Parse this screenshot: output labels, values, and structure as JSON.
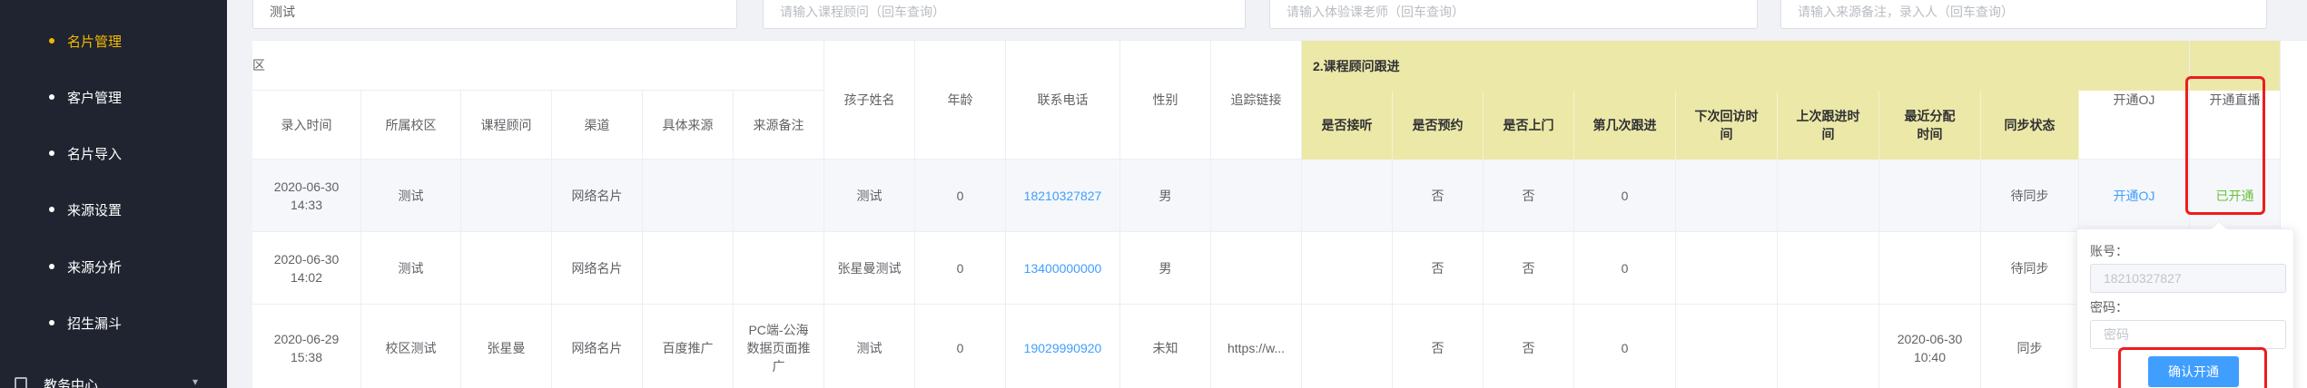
{
  "sidebar": {
    "items": [
      {
        "label": "名片管理",
        "active": true
      },
      {
        "label": "客户管理"
      },
      {
        "label": "名片导入"
      },
      {
        "label": "来源设置"
      },
      {
        "label": "来源分析"
      },
      {
        "label": "招生漏斗"
      }
    ],
    "group": {
      "label": "教务中心"
    }
  },
  "filters": {
    "campus_value": "测试",
    "consultant_placeholder": "请输入课程顾问（回车查询）",
    "teacher_placeholder": "请输入体验课老师（回车查询）",
    "source_placeholder": "请输入来源备注，录入人（回车查询）"
  },
  "table": {
    "group_partial": "区",
    "group2_title": "2.课程顾问跟进",
    "headers": {
      "entry_time": "录入时间",
      "campus": "所属校区",
      "consultant": "课程顾问",
      "channel": "渠道",
      "source": "具体来源",
      "source_note": "来源备注",
      "child_name": "孩子姓名",
      "age": "年龄",
      "phone": "联系电话",
      "gender": "性别",
      "tracking_link": "追踪链接",
      "answered": "是否接听",
      "appointment": "是否预约",
      "visited": "是否上门",
      "follow_count": "第几次跟进",
      "next_visit": "下次回访时间",
      "last_follow": "上次跟进时间",
      "last_assign": "最近分配时间",
      "sync_status": "同步状态",
      "open_oj": "开通OJ",
      "open_live": "开通直播"
    },
    "rows": [
      {
        "entry_time": "2020-06-30 14:33",
        "campus": "测试",
        "consultant": "",
        "channel": "网络名片",
        "source": "",
        "source_note": "",
        "child_name": "测试",
        "age": "0",
        "phone": "18210327827",
        "gender": "男",
        "tracking_link": "",
        "answered": "",
        "appointment": "否",
        "visited": "否",
        "follow_count": "0",
        "next_visit": "",
        "last_follow": "",
        "last_assign": "",
        "sync_status": "待同步",
        "open_oj": "开通OJ",
        "open_live": "已开通"
      },
      {
        "entry_time": "2020-06-30 14:02",
        "campus": "测试",
        "consultant": "",
        "channel": "网络名片",
        "source": "",
        "source_note": "",
        "child_name": "张星曼测试",
        "age": "0",
        "phone": "13400000000",
        "gender": "男",
        "tracking_link": "",
        "answered": "",
        "appointment": "否",
        "visited": "否",
        "follow_count": "0",
        "next_visit": "",
        "last_follow": "",
        "last_assign": "",
        "sync_status": "待同步",
        "open_oj": "",
        "open_live": ""
      },
      {
        "entry_time": "2020-06-29 15:38",
        "campus": "校区测试",
        "consultant": "张星曼",
        "channel": "网络名片",
        "source": "百度推广",
        "source_note": "PC端-公海数据页面推广",
        "child_name": "测试",
        "age": "0",
        "phone": "19029990920",
        "gender": "未知",
        "tracking_link": "https://w...",
        "answered": "",
        "appointment": "否",
        "visited": "否",
        "follow_count": "0",
        "next_visit": "",
        "last_follow": "",
        "last_assign": "2020-06-30 10:40",
        "sync_status": "同步",
        "open_oj": "",
        "open_live": ""
      }
    ]
  },
  "popover": {
    "account_label": "账号：",
    "account_placeholder": "18210327827",
    "password_label": "密码：",
    "password_placeholder": "密码",
    "confirm_label": "确认开通"
  },
  "colors": {
    "sidebar_bg": "#1f2430",
    "active": "#f5b800",
    "header_yellow": "#ece8a8",
    "link": "#409eff",
    "success": "#67c23a",
    "highlight_box": "#ee1c1c"
  }
}
